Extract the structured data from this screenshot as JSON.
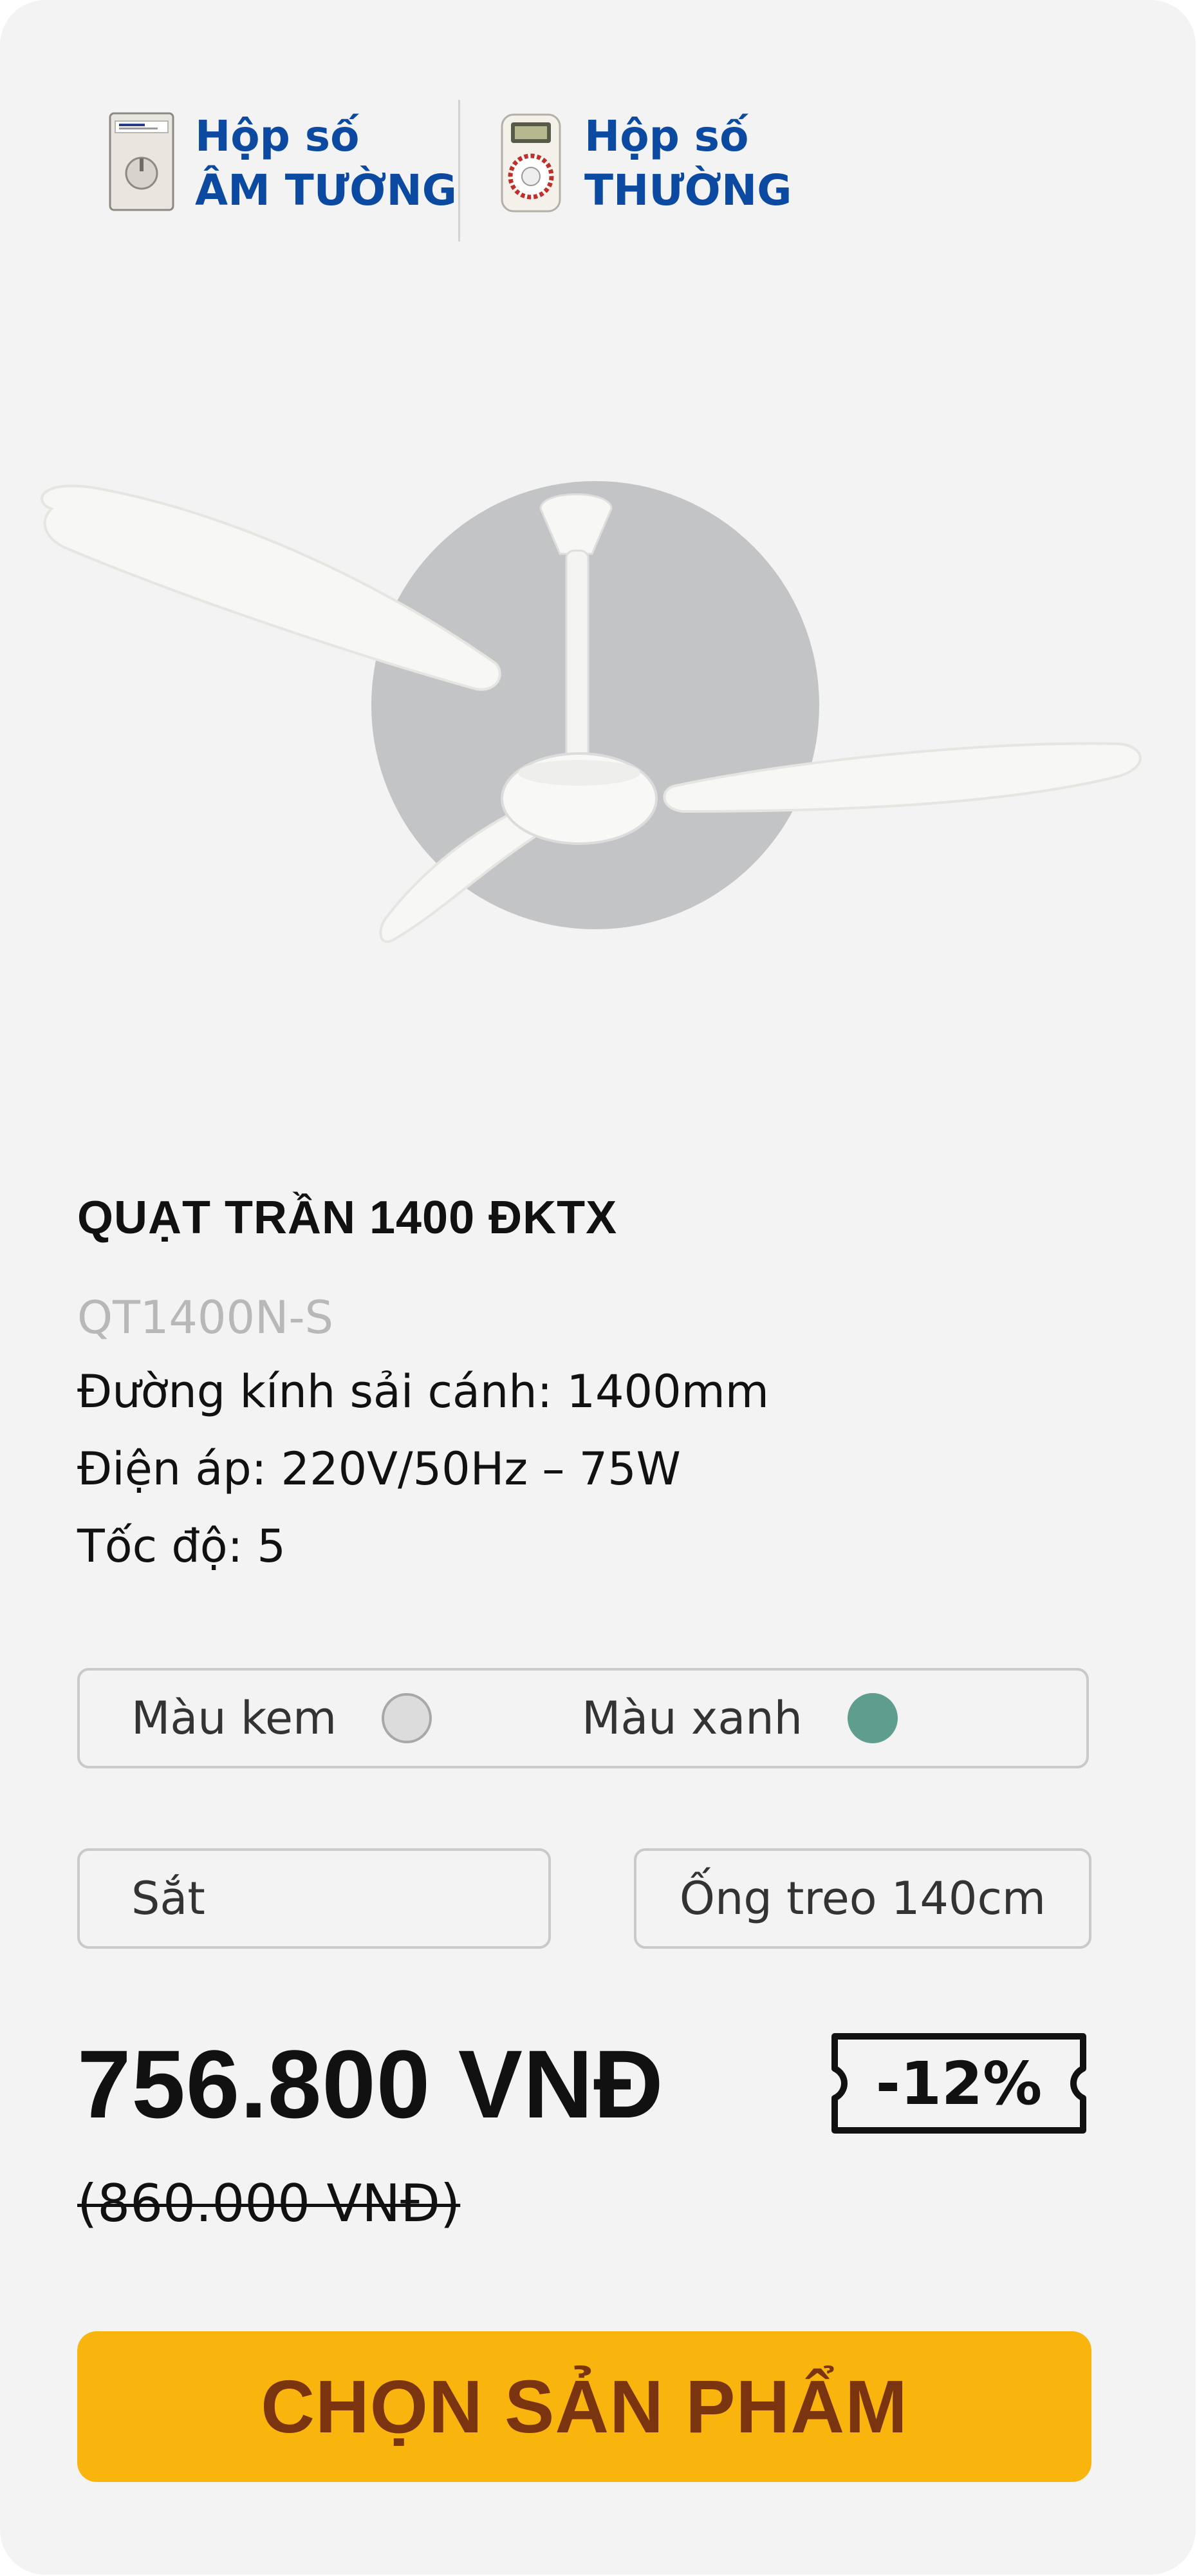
{
  "gearbox_tabs": [
    {
      "line1": "Hộp số",
      "line2": "ÂM TƯỜNG",
      "icon": "wall-gearbox-icon"
    },
    {
      "line1": "Hộp số",
      "line2": "THƯỜNG",
      "icon": "regular-gearbox-icon"
    }
  ],
  "product": {
    "image": "ceiling-fan-image",
    "title": "QUẠT TRẦN 1400 ĐKTX",
    "code": "QT1400N-S",
    "specs": [
      "Đường kính sải cánh: 1400mm",
      "Điện áp: 220V/50Hz – 75W",
      "Tốc độ: 5"
    ]
  },
  "colors": [
    {
      "label": "Màu kem",
      "swatch": "#dcdcdc"
    },
    {
      "label": "Màu xanh",
      "swatch": "#5f9d8f"
    }
  ],
  "options": {
    "material": "Sắt",
    "rod": "Ống treo 140cm"
  },
  "pricing": {
    "price": "756.800 VNĐ",
    "original_price": "(860.000 VNĐ)",
    "discount": "-12%"
  },
  "cta": {
    "label": "CHỌN SẢN PHẨM",
    "color": "#f9b50e",
    "text_color": "#7a3510"
  }
}
